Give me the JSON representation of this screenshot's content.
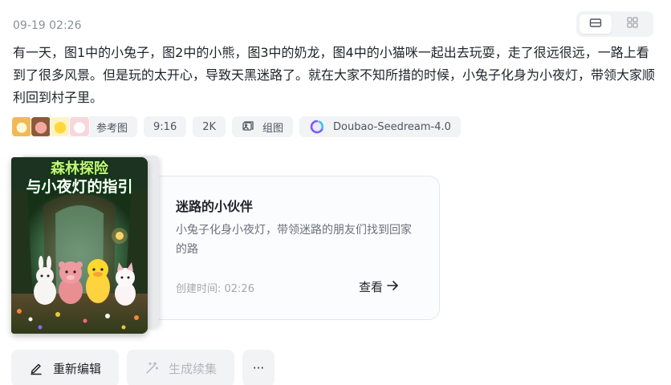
{
  "timestamp": "09-19 02:26",
  "view_toggle": {
    "icons": [
      "single-view-icon",
      "grid-view-icon"
    ],
    "active": "single-view-icon"
  },
  "prompt": "有一天，图1中的小兔子，图2中的小熊，图3中的奶龙，图4中的小猫咪一起出去玩耍，走了很远很远，一路上看到了很多风景。但是玩的太开心，导致天黑迷路了。就在大家不知所措的时候，小兔子化身为小夜灯，带领大家顺利回到村子里。",
  "meta": {
    "reference_label": "参考图",
    "reference_count": 4,
    "ratio": "9:16",
    "resolution": "2K",
    "mode_label": "组图",
    "model": "Doubao-Seedream-4.0"
  },
  "card": {
    "cover_title_line1": "森林探险",
    "cover_title_line1_suffix": "与",
    "cover_title_line2": "与小夜灯的指引",
    "title": "迷路的小伙伴",
    "description": "小兔子化身小夜灯，带领迷路的朋友们找到回家的路",
    "created": "创建时间: 02:26",
    "view_label": "查看"
  },
  "actions": {
    "reedit": "重新编辑",
    "continue": "生成续集",
    "more": "···"
  },
  "colors": {
    "text": "#1f2329",
    "muted": "#8a8f99",
    "chip_bg": "#f2f3f5",
    "border": "#e3e6ea"
  }
}
